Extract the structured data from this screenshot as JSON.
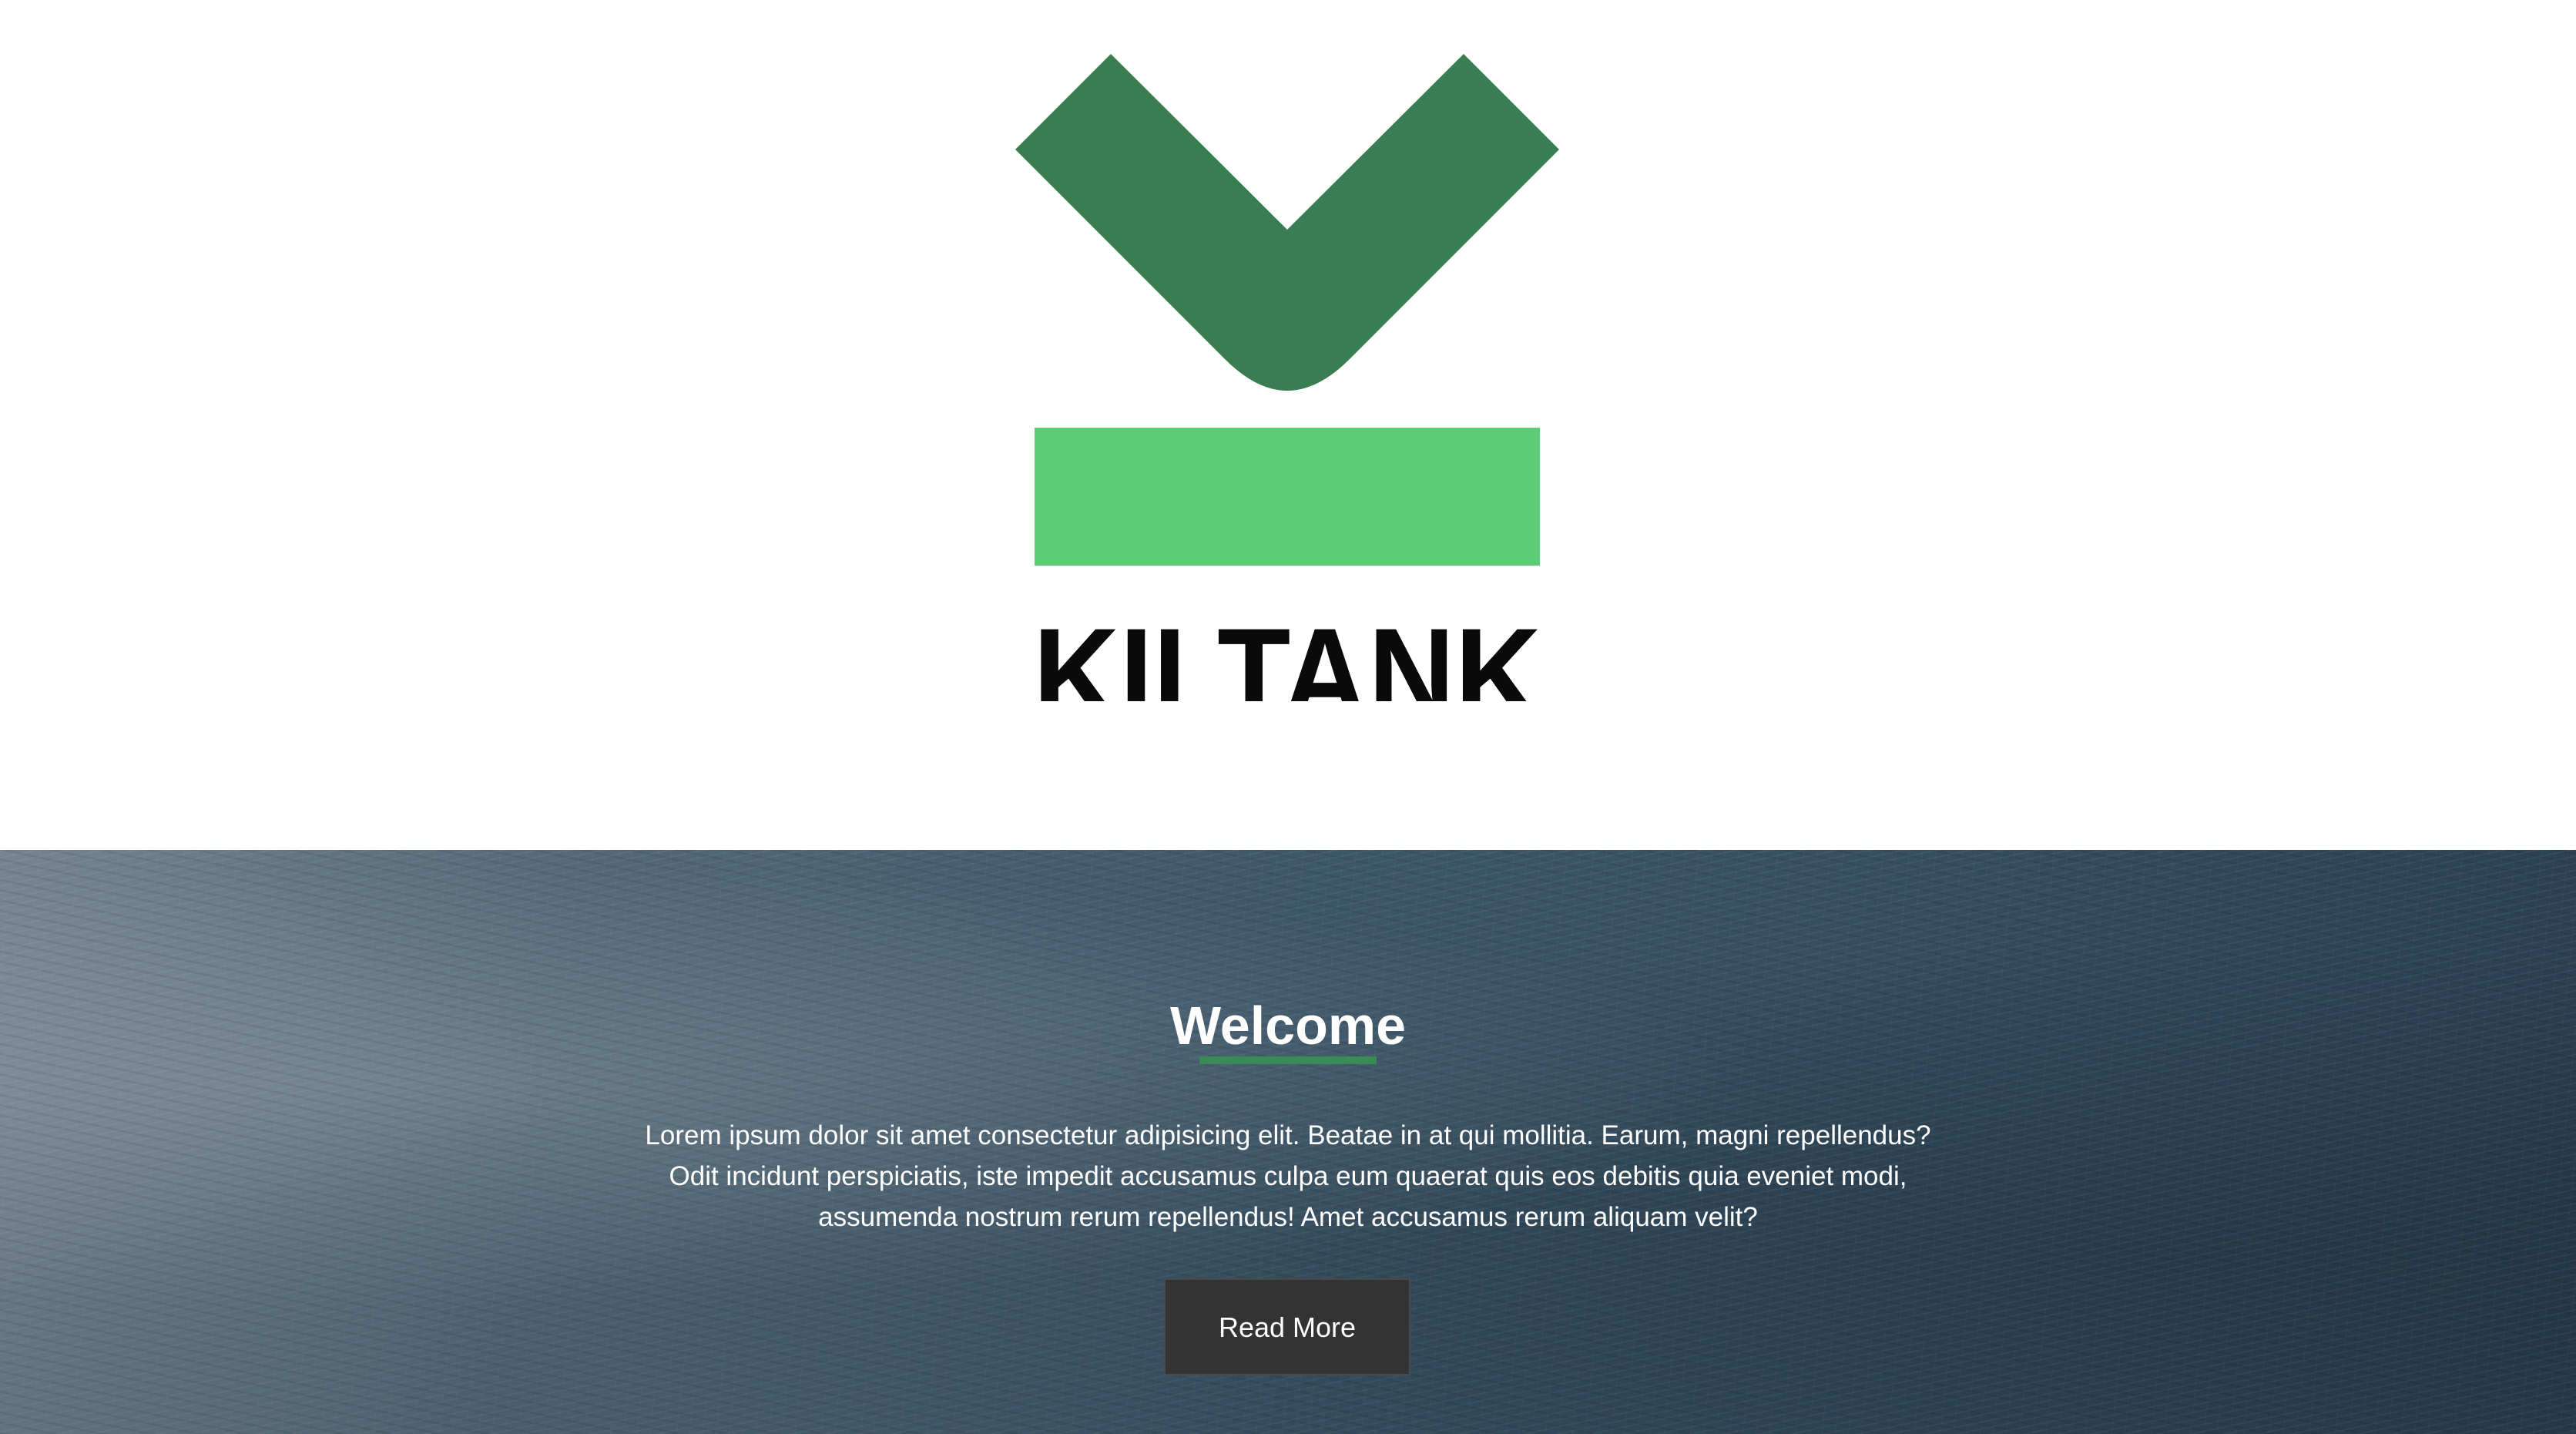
{
  "colors": {
    "logo_dark_green": "#3a7d52",
    "logo_light_green": "#5ccd76",
    "logo_text": "#0a0a0a",
    "accent_underline": "#3a8a55",
    "button_bg": "#333333"
  },
  "header": {
    "logo": {
      "wordmark": "KILTANK",
      "icon": "kiltank-chevron-logo"
    }
  },
  "hero": {
    "background": "ocean-water-texture",
    "title": "Welcome",
    "body": "Lorem ipsum dolor sit amet consectetur adipisicing elit. Beatae in at qui mollitia. Earum, magni repellendus? Odit incidunt perspiciatis, iste impedit accusamus culpa eum quaerat quis eos debitis quia eveniet modi, assumenda nostrum rerum repellendus! Amet accusamus rerum aliquam velit?",
    "button_label": "Read More"
  }
}
